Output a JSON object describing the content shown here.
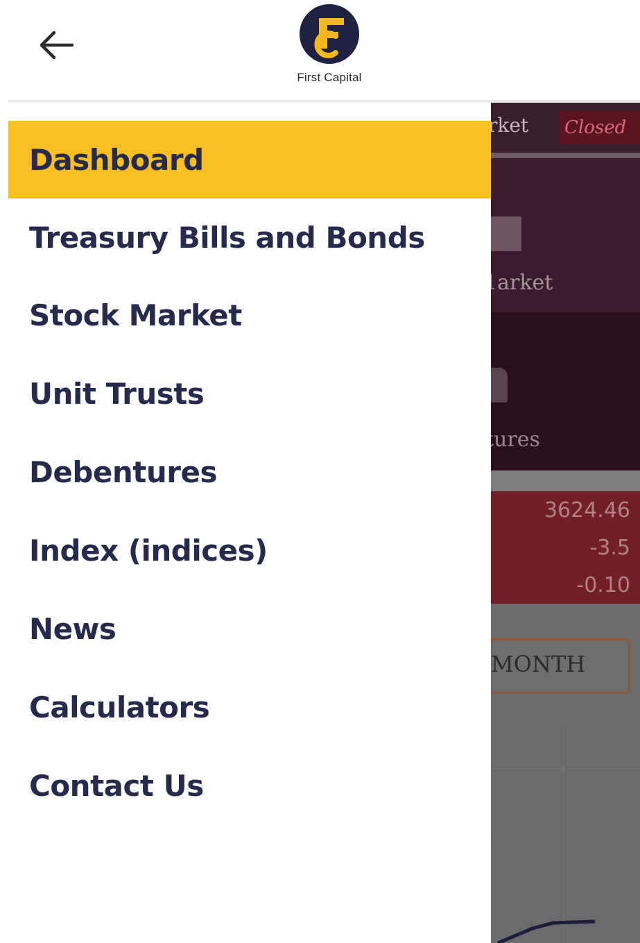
{
  "header": {
    "back_icon": "arrow-left-icon",
    "logo_icon": "first-capital-logo-icon",
    "logo_caption": "First Capital"
  },
  "drawer": {
    "items": [
      {
        "label": "Dashboard",
        "active": true
      },
      {
        "label": "Treasury Bills and Bonds",
        "active": false
      },
      {
        "label": "Stock Market",
        "active": false
      },
      {
        "label": "Unit Trusts",
        "active": false
      },
      {
        "label": "Debentures",
        "active": false
      },
      {
        "label": "Index (indices)",
        "active": false
      },
      {
        "label": "News",
        "active": false
      },
      {
        "label": "Calculators",
        "active": false
      },
      {
        "label": "Contact Us",
        "active": false
      }
    ]
  },
  "background_app": {
    "status_label": "rket",
    "status_value": "Closed",
    "tile1_label": "1arket",
    "tile2_label": "tures",
    "index_values": [
      "3624.46",
      "-3.5",
      "-0.10"
    ],
    "month_button_label": "MONTH"
  },
  "colors": {
    "accent": "#f7bf22",
    "menu_text": "#262a4c",
    "scrim": "#6b6b6d",
    "closed_badge": "#5a1420",
    "index_bg": "#722028"
  }
}
